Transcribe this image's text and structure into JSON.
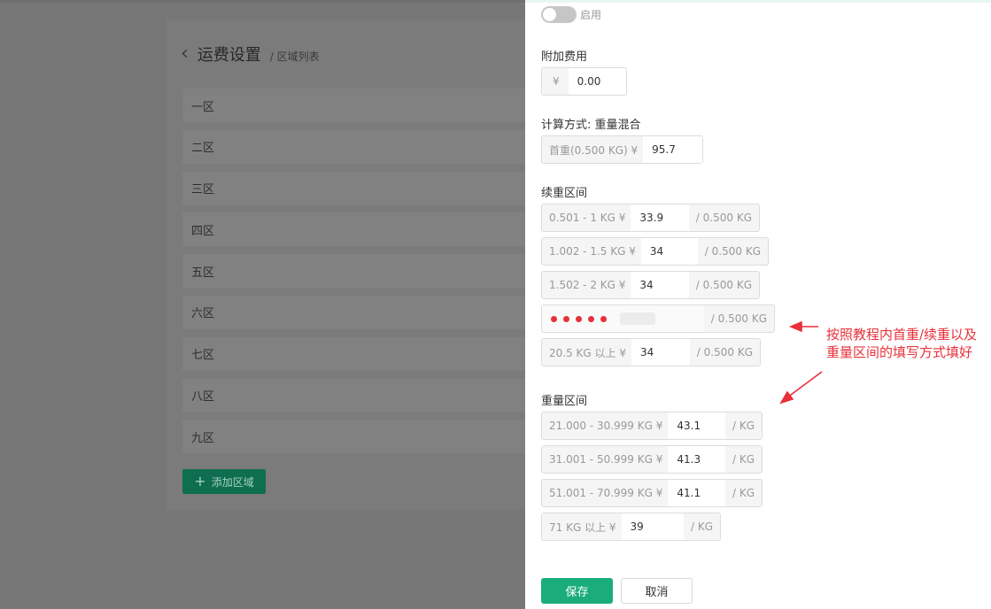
{
  "background": {
    "title": "运费设置",
    "subtitle": "/ 区域列表",
    "zones": [
      "一区",
      "二区",
      "三区",
      "四区",
      "五区",
      "六区",
      "七区",
      "八区",
      "九区"
    ],
    "add_button": "添加区域",
    "add_icon": "+"
  },
  "drawer": {
    "toggle_label": "启用",
    "extra_fee": {
      "label": "附加费用",
      "prefix": "¥",
      "value": "0.00"
    },
    "calc_method": {
      "label": "计算方式: 重量混合",
      "prefix": "首重(0.500 KG) ¥",
      "value": "95.7"
    },
    "continued": {
      "label": "续重区间",
      "rows": [
        {
          "prefix": "0.501 - 1 KG ¥",
          "value": "33.9",
          "suffix": "/ 0.500 KG"
        },
        {
          "prefix": "1.002 - 1.5 KG ¥",
          "value": "34",
          "suffix": "/ 0.500 KG"
        },
        {
          "prefix": "1.502 - 2 KG ¥",
          "value": "34",
          "suffix": "/ 0.500 KG"
        },
        {
          "prefix": "",
          "value": "",
          "suffix": "/ 0.500 KG"
        },
        {
          "prefix": "20.5 KG 以上 ¥",
          "value": "34",
          "suffix": "/ 0.500 KG"
        }
      ]
    },
    "weight": {
      "label": "重量区间",
      "rows": [
        {
          "prefix": "21.000 - 30.999 KG ¥",
          "value": "43.1",
          "suffix": "/ KG"
        },
        {
          "prefix": "31.001 - 50.999 KG ¥",
          "value": "41.3",
          "suffix": "/ KG"
        },
        {
          "prefix": "51.001 - 70.999 KG ¥",
          "value": "41.1",
          "suffix": "/ KG"
        },
        {
          "prefix": "71 KG 以上 ¥",
          "value": "39",
          "suffix": "/ KG"
        }
      ]
    },
    "save": "保存",
    "cancel": "取消"
  },
  "annotation": {
    "line1": "按照教程内首重/续重以及",
    "line2": "重量区间的填写方式填好",
    "color": "#e8303a"
  }
}
